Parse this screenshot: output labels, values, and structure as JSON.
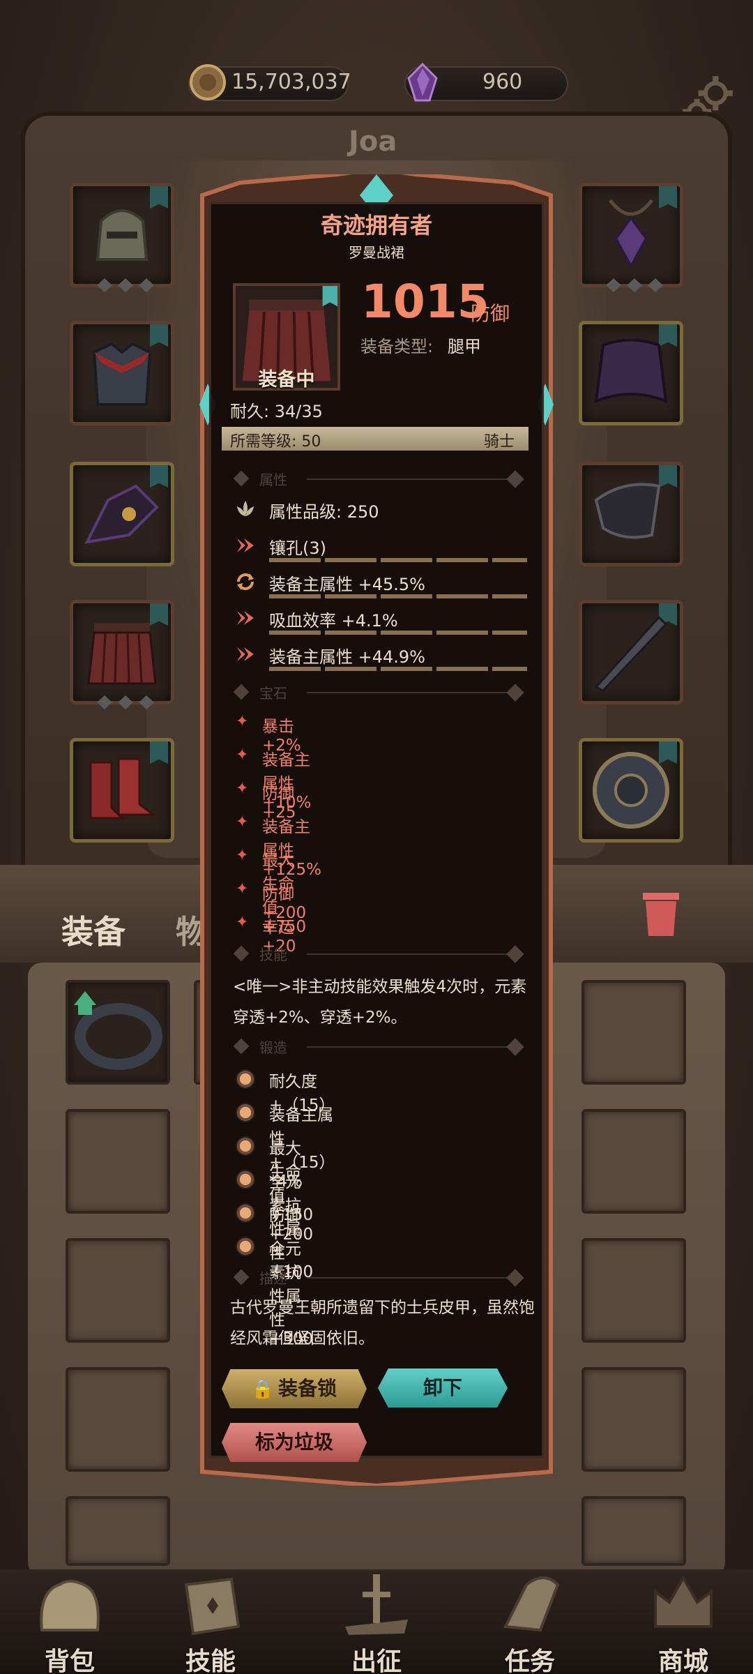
{
  "resources": {
    "gold": "15,703,037",
    "gems": "960"
  },
  "character_name": "Joa",
  "tabs": {
    "equipment": "装备",
    "items": "物品"
  },
  "item": {
    "title": "奇迹拥有者",
    "name": "罗曼战裙",
    "equipped_label": "装备中",
    "defense_value": "1015",
    "defense_unit": "防御",
    "type_label": "装备类型:",
    "type_value": "腿甲",
    "durability": "耐久: 34/35",
    "required_level": "所需等级: 50",
    "class": "骑士"
  },
  "sections": {
    "attributes": "属性",
    "gems": "宝石",
    "skills": "技能",
    "forge": "锻造",
    "description": "描述"
  },
  "attributes": [
    {
      "icon": "lotus-icon",
      "text": "属性品级: 250"
    },
    {
      "icon": "socket-icon",
      "text": "镶孔(3)"
    },
    {
      "icon": "refresh-icon",
      "text": "装备主属性 +45.5%"
    },
    {
      "icon": "arrow-icon",
      "text": "吸血效率 +4.1%"
    },
    {
      "icon": "arrow-icon",
      "text": "装备主属性 +44.9%"
    }
  ],
  "gems": [
    "暴击 +2%",
    "装备主属性 +10%",
    "防御 +25",
    "装备主属性 +125%",
    "最大生命值 +750",
    "防御 +200",
    "幸运 +20"
  ],
  "skill_text": "<唯一>非主动技能效果触发4次时，元素穿透+2%、穿透+2%。",
  "forge": [
    "耐久度+（15）",
    "装备主属性+（15）*4%",
    "最大生命值 +150",
    "全元素抗性属性 +100",
    "防御 +200",
    "全元素抗性属性 +300"
  ],
  "description": "古代罗曼王朝所遗留下的士兵皮甲，虽然饱经风霜但坚固依旧。",
  "buttons": {
    "lock": "装备锁",
    "unequip": "卸下",
    "mark_junk": "标为垃圾"
  },
  "bottom_nav": [
    {
      "icon": "backpack-icon",
      "label": "背包"
    },
    {
      "icon": "skill-book-icon",
      "label": "技能"
    },
    {
      "icon": "sword-icon",
      "label": "出征"
    },
    {
      "icon": "quest-scroll-icon",
      "label": "任务"
    },
    {
      "icon": "castle-icon",
      "label": "商城"
    }
  ],
  "colors": {
    "accent_red": "#f28a6a",
    "gem_text": "#f08068",
    "teal": "#5fd0c8",
    "gold": "#cfb06a"
  }
}
